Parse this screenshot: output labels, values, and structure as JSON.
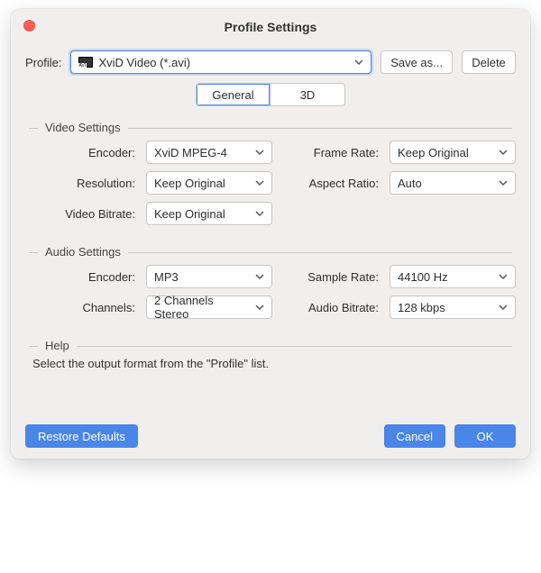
{
  "window": {
    "title": "Profile Settings"
  },
  "profile": {
    "label": "Profile:",
    "value": "XviD Video (*.avi)",
    "save_as_label": "Save as...",
    "delete_label": "Delete"
  },
  "tabs": {
    "general": "General",
    "threeD": "3D"
  },
  "video": {
    "legend": "Video Settings",
    "encoder_label": "Encoder:",
    "encoder_value": "XviD MPEG-4",
    "framerate_label": "Frame Rate:",
    "framerate_value": "Keep Original",
    "resolution_label": "Resolution:",
    "resolution_value": "Keep Original",
    "aspect_label": "Aspect Ratio:",
    "aspect_value": "Auto",
    "bitrate_label": "Video Bitrate:",
    "bitrate_value": "Keep Original"
  },
  "audio": {
    "legend": "Audio Settings",
    "encoder_label": "Encoder:",
    "encoder_value": "MP3",
    "samplerate_label": "Sample Rate:",
    "samplerate_value": "44100 Hz",
    "channels_label": "Channels:",
    "channels_value": "2 Channels Stereo",
    "bitrate_label": "Audio Bitrate:",
    "bitrate_value": "128 kbps"
  },
  "help": {
    "legend": "Help",
    "text": "Select the output format from the \"Profile\" list."
  },
  "footer": {
    "restore_label": "Restore Defaults",
    "cancel_label": "Cancel",
    "ok_label": "OK"
  }
}
